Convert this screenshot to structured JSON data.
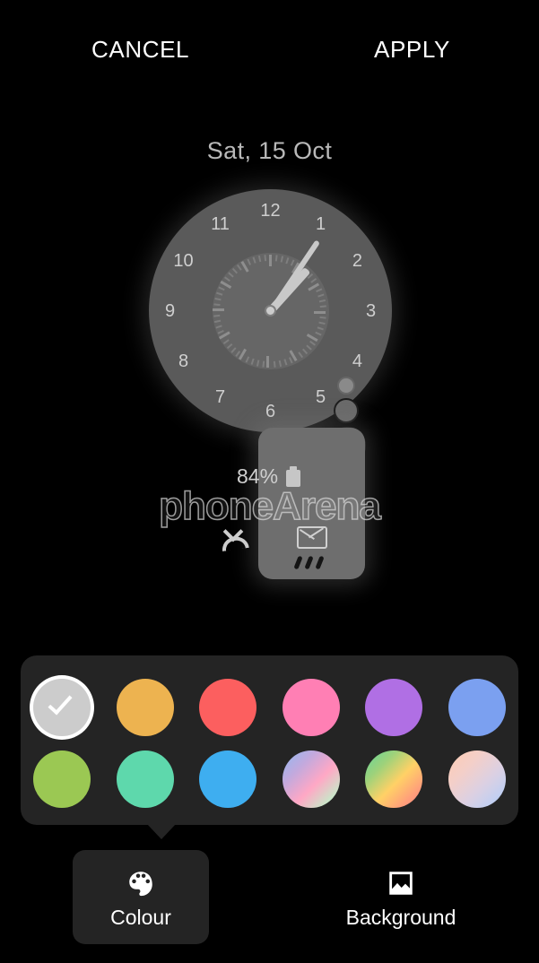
{
  "header": {
    "cancel_label": "CANCEL",
    "apply_label": "APPLY"
  },
  "preview": {
    "date": "Sat, 15 Oct",
    "clock": {
      "numerals": [
        "1",
        "2",
        "3",
        "4",
        "5",
        "6",
        "7",
        "8",
        "9",
        "10",
        "11",
        "12"
      ],
      "hour_hand_degrees": 42,
      "minute_hand_degrees": 34,
      "face_color": "#5a5a5a",
      "inner_face_color": "#666666"
    },
    "widget": {
      "battery_percent": "84%",
      "battery_icon": "battery-icon",
      "mail_icon": "envelope-icon",
      "handle_icon": "resize-handle-dots"
    },
    "watermark": {
      "text": "phoneArena",
      "missed_call_icon": "missed-call-icon"
    }
  },
  "colour_panel": {
    "swatches_row1": [
      {
        "name": "selected-grey",
        "color": "#cccccc",
        "selected": true
      },
      {
        "name": "amber",
        "color": "#edb350",
        "selected": false
      },
      {
        "name": "red",
        "color": "#fc5f5f",
        "selected": false
      },
      {
        "name": "pink",
        "color": "#ff7fb4",
        "selected": false
      },
      {
        "name": "purple",
        "color": "#b06fe4",
        "selected": false
      },
      {
        "name": "blue",
        "color": "#7ba0f0",
        "selected": false
      }
    ],
    "swatches_row2": [
      {
        "name": "green",
        "color": "#9bc853",
        "selected": false
      },
      {
        "name": "mint",
        "color": "#5ed8ac",
        "selected": false
      },
      {
        "name": "sky-blue",
        "color": "#3eaef0",
        "selected": false
      },
      {
        "name": "gradient-blue-pink-mint",
        "color": "linear-gradient(135deg,#8fb9f2 0%,#c3a9dd 30%,#ffa8c5 58%,#c9e7c9 85%,#b9ecd2 100%)",
        "selected": false
      },
      {
        "name": "gradient-green-yellow-red",
        "color": "linear-gradient(135deg,#63d49a 0%,#9ed27a 28%,#ffd166 55%,#ff9f7a 80%,#ff8080 100%)",
        "selected": false
      },
      {
        "name": "gradient-peach-lavender-blue",
        "color": "linear-gradient(135deg,#ffcdb2 0%,#f3cfc9 32%,#dcd0e2 60%,#c3cff0 82%,#9dc0f0 100%)",
        "selected": false
      }
    ]
  },
  "tabs": [
    {
      "name": "colour",
      "label": "Colour",
      "icon": "palette-icon",
      "active": true
    },
    {
      "name": "background",
      "label": "Background",
      "icon": "image-icon",
      "active": false
    }
  ]
}
